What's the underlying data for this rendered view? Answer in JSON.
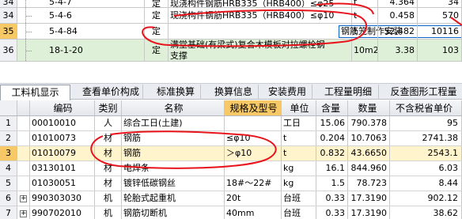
{
  "top_grid": {
    "rows": [
      {
        "num": "34",
        "code": "5-4-7",
        "type": "定",
        "name": "现浇构件钢筋HRB335（HRB400）≤φ25",
        "unit": "t",
        "qty": "4.364",
        "price": "34"
      },
      {
        "num": "34",
        "code": "5-4-6",
        "type": "定",
        "name": "现浇构件钢筋HRB335（HRB400）≤φ10",
        "unit": "t",
        "qty": "0.458",
        "price": "570"
      },
      {
        "num": "35",
        "code": "5-4-84",
        "type": "定",
        "name": "钢筋笼制作安装",
        "unit": "t",
        "qty": "52.482",
        "price": "10116"
      },
      {
        "num": "36",
        "code": "18-1-20",
        "type": "定",
        "name_line1": "满堂基础(有梁式)复合木模板对拉螺栓钢",
        "name_line2": "支撑",
        "unit": "10m2",
        "qty": "3.38",
        "price": "103"
      }
    ]
  },
  "tabs": [
    "工料机显示",
    "查看单价构成",
    "标准换算",
    "换算信息",
    "安装费用",
    "工程量明细",
    "反查图形工程量"
  ],
  "bottom_grid": {
    "headers": [
      "编码",
      "类别",
      "名称",
      "规格及型号",
      "单位",
      "含量",
      "数量",
      "不含税省单价"
    ],
    "rows": [
      {
        "num": "1",
        "exp": "",
        "code": "00010010",
        "cat": "人",
        "name": "综合工日(土建)",
        "spec": "",
        "unit": "工日",
        "cnt": "15.06",
        "qty": "790.378",
        "price": "95"
      },
      {
        "num": "2",
        "exp": "",
        "code": "01010073",
        "cat": "材",
        "name": "钢筋",
        "spec": "≤φ10",
        "unit": "t",
        "cnt": "0.204",
        "qty": "10.7063",
        "price": "2741.38"
      },
      {
        "num": "3",
        "exp": "",
        "code": "01010079",
        "cat": "材",
        "name": "钢筋",
        "spec": "＞φ10",
        "unit": "t",
        "cnt": "0.832",
        "qty": "43.6650",
        "price": "2543.1"
      },
      {
        "num": "4",
        "exp": "",
        "code": "03130101",
        "cat": "材",
        "name": "电焊条",
        "spec": "",
        "unit": "kg",
        "cnt": "16.1",
        "qty": "844.960",
        "price": "6.03"
      },
      {
        "num": "5",
        "exp": "",
        "code": "01030051",
        "cat": "材",
        "name": "镀锌低碳钢丝",
        "spec": "18#～22#",
        "unit": "kg",
        "cnt": "1.5",
        "qty": "78.723",
        "price": "8.44"
      },
      {
        "num": "6",
        "exp": "+",
        "code": "990303030",
        "cat": "机",
        "name": "轮胎式起重机",
        "spec": "20t",
        "unit": "台班",
        "cnt": "0.33",
        "qty": "17.3190",
        "price": "902.12"
      },
      {
        "num": "7",
        "exp": "+",
        "code": "990702010",
        "cat": "机",
        "name": "钢筋切断机",
        "spec": "40mm",
        "unit": "台班",
        "cnt": "0.33",
        "qty": "17.3190",
        "price": "38.62"
      }
    ]
  },
  "annotation_color": "#e8141c"
}
